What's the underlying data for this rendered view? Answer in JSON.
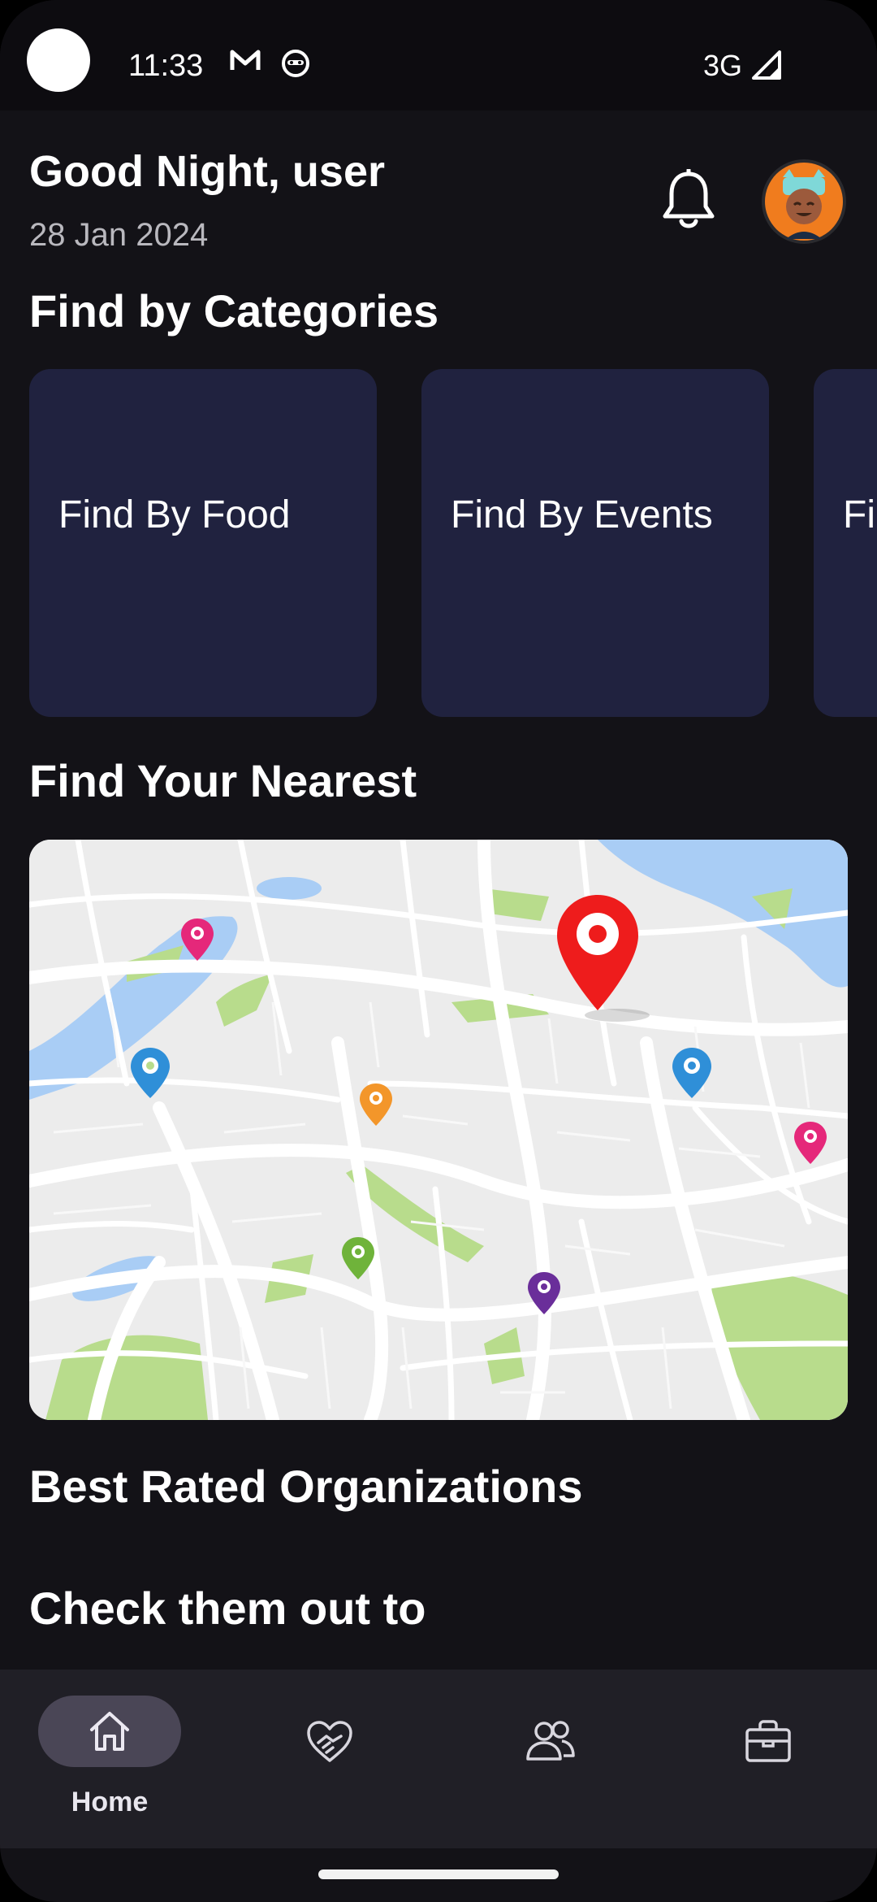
{
  "status_bar": {
    "time": "11:33",
    "network": "3G"
  },
  "header": {
    "greeting": "Good Night, user",
    "date": "28 Jan 2024"
  },
  "categories": {
    "title": "Find by Categories",
    "items": [
      {
        "label": "Find By Food"
      },
      {
        "label": "Find By Events"
      },
      {
        "label": "Find By Te"
      }
    ]
  },
  "nearest": {
    "title": "Find Your Nearest"
  },
  "organizations": {
    "title": "Best Rated Organizations"
  },
  "check": {
    "title": "Check them out to"
  },
  "bottom_nav": {
    "items": [
      {
        "label": "Home",
        "icon": "home-icon"
      },
      {
        "label": "",
        "icon": "volunteer-icon"
      },
      {
        "label": "",
        "icon": "people-icon"
      },
      {
        "label": "",
        "icon": "briefcase-icon"
      }
    ]
  },
  "colors": {
    "background": "#131217",
    "card": "#20223f",
    "nav_bg": "#201f26",
    "nav_active_pill": "#4a4656",
    "avatar_orange": "#f07c1e",
    "pin_red": "#ee1c1c"
  }
}
